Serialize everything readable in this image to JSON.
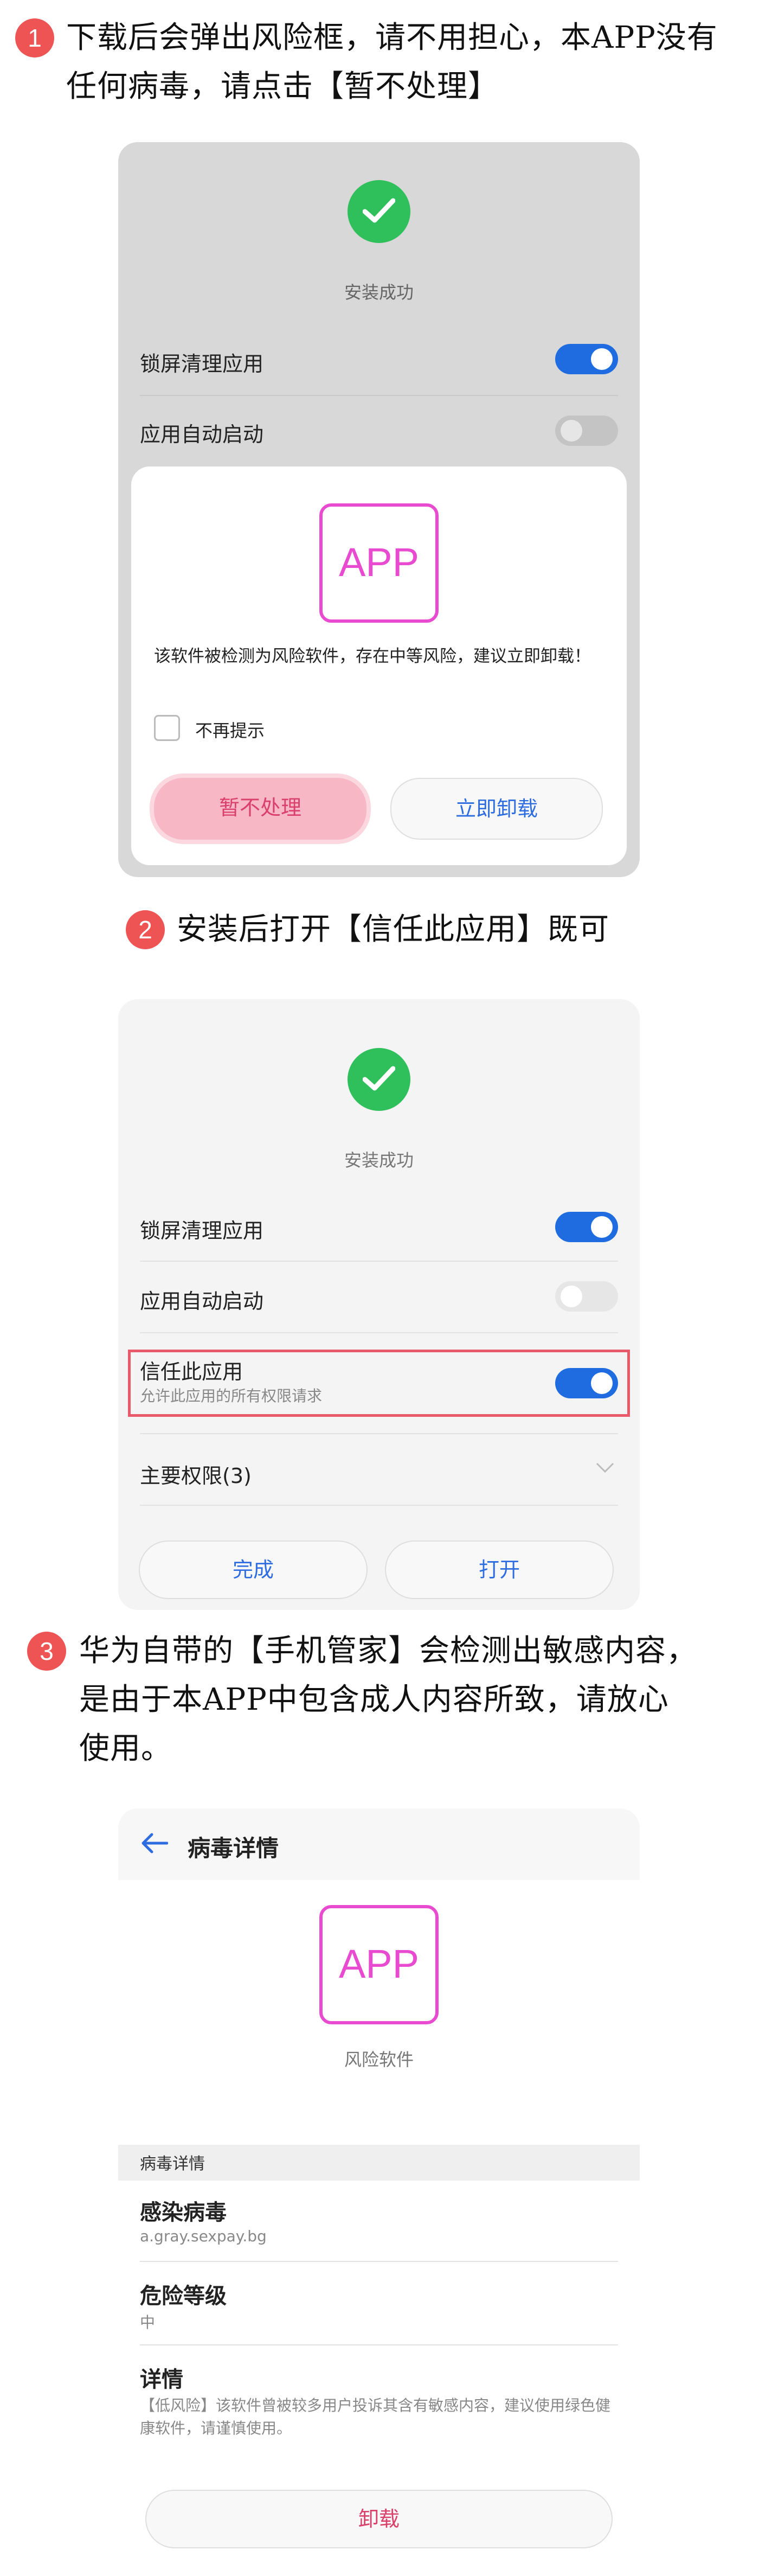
{
  "steps": [
    {
      "num": "1",
      "line1": "下载后会弹出风险框，请不用担心，本APP没有",
      "line2": "任何病毒，请点击【暂不处理】"
    },
    {
      "num": "2",
      "line1": "安装后打开【信任此应用】既可"
    },
    {
      "num": "3",
      "line1": "华为自带的【手机管家】会检测出敏感内容，",
      "line2": "是由于本APP中包含成人内容所致，请放心",
      "line3": "使用。"
    }
  ],
  "screen1": {
    "install_success": "安装成功",
    "rows": [
      {
        "label": "锁屏清理应用",
        "on": true
      },
      {
        "label": "应用自动启动",
        "on": false
      }
    ],
    "dialog": {
      "app_label": "APP",
      "message": "该软件被检测为风险软件，存在中等风险，建议立即卸载！",
      "checkbox_label": "不再提示",
      "ignore_button": "暂不处理",
      "uninstall_button": "立即卸载"
    }
  },
  "screen2": {
    "install_success": "安装成功",
    "rows": [
      {
        "label": "锁屏清理应用",
        "on": true
      },
      {
        "label": "应用自动启动",
        "on": false
      }
    ],
    "trust": {
      "label": "信任此应用",
      "sub": "允许此应用的所有权限请求",
      "on": true
    },
    "permissions": "主要权限(3)",
    "done_button": "完成",
    "open_button": "打开"
  },
  "screen3": {
    "title": "病毒详情",
    "app_label": "APP",
    "app_caption": "风险软件",
    "section": "病毒详情",
    "items": [
      {
        "label": "感染病毒",
        "value": "a.gray.sexpay.bg"
      },
      {
        "label": "危险等级",
        "value": "中"
      },
      {
        "label": "详情",
        "value": "【低风险】该软件曾被较多用户投诉其含有敏感内容，建议使用绿色健康软件，请谨慎使用。"
      }
    ],
    "uninstall_button": "卸载"
  },
  "colors": {
    "accent_red": "#ef5454",
    "toggle_blue": "#1f6ce0",
    "app_pink": "#e84bd0",
    "check_green": "#2fbf5b"
  }
}
